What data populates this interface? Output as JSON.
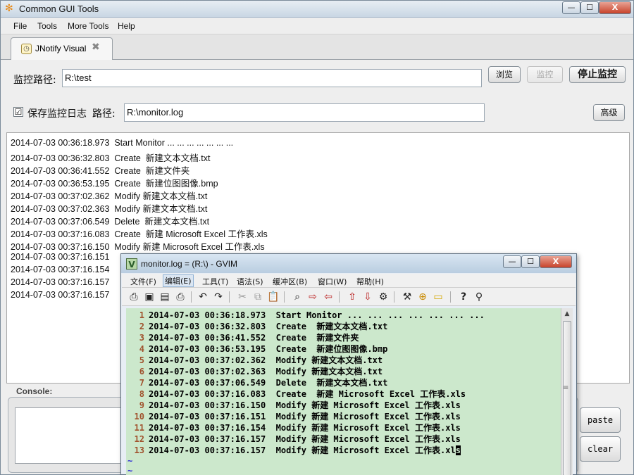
{
  "window": {
    "title": "Common GUI Tools",
    "buttons": {
      "minimize": "—",
      "maximize": "☐",
      "close": "X"
    }
  },
  "menu": [
    "File",
    "Tools",
    "More Tools",
    "Help"
  ],
  "tab": {
    "label": "JNotify Visual",
    "close": "✖",
    "icon": "◷"
  },
  "monitor": {
    "path_label": "监控路径:",
    "path_value": "R:\\test",
    "browse": "浏览",
    "monitor_btn": "监控",
    "stop_btn": "停止监控"
  },
  "logging": {
    "checkbox_label": "保存监控日志",
    "checked": "☑",
    "path_label": "路径:",
    "path_value": "R:\\monitor.log",
    "advanced": "高级"
  },
  "log_lines": [
    "2014-07-03 00:36:18.973  Start Monitor ... ... ... ... ... ... ...",
    "2014-07-03 00:36:32.803  Create  新建文本文档.txt",
    "2014-07-03 00:36:41.552  Create  新建文件夹",
    "2014-07-03 00:36:53.195  Create  新建位图图像.bmp",
    "2014-07-03 00:37:02.362  Modify 新建文本文档.txt",
    "2014-07-03 00:37:02.363  Modify 新建文本文档.txt",
    "2014-07-03 00:37:06.549  Delete  新建文本文档.txt",
    "2014-07-03 00:37:16.083  Create  新建 Microsoft Excel 工作表.xls",
    "2014-07-03 00:37:16.150  Modify 新建 Microsoft Excel 工作表.xls",
    "2014-07-03 00:37:16.151",
    "2014-07-03 00:37:16.154",
    "2014-07-03 00:37:16.157",
    "2014-07-03 00:37:16.157"
  ],
  "console": {
    "label": "Console:",
    "paste": "paste",
    "clear": "clear"
  },
  "gvim": {
    "title": "monitor.log = (R:\\) - GVIM",
    "menu": [
      "文件(F)",
      "编辑(E)",
      "工具(T)",
      "语法(S)",
      "缓冲区(B)",
      "窗口(W)",
      "帮助(H)"
    ],
    "active_menu_index": 1,
    "toolbar_icons": [
      "open-icon",
      "save-icon",
      "save-all-icon",
      "print-icon",
      "undo-icon",
      "redo-icon",
      "cut-icon",
      "copy-icon",
      "paste-icon",
      "find-replace-icon",
      "find-next-icon",
      "find-prev-icon",
      "load-session-icon",
      "save-session-icon",
      "run-script-icon",
      "make-icon",
      "shell-icon",
      "tag-jump-icon",
      "help-icon",
      "find-help-icon"
    ],
    "lines": [
      {
        "n": "1",
        "text": "2014-07-03 00:36:18.973  Start Monitor ... ... ... ... ... ... ..."
      },
      {
        "n": "2",
        "text": "2014-07-03 00:36:32.803  Create  新建文本文档.txt"
      },
      {
        "n": "3",
        "text": "2014-07-03 00:36:41.552  Create  新建文件夹"
      },
      {
        "n": "4",
        "text": "2014-07-03 00:36:53.195  Create  新建位图图像.bmp"
      },
      {
        "n": "5",
        "text": "2014-07-03 00:37:02.362  Modify 新建文本文档.txt"
      },
      {
        "n": "6",
        "text": "2014-07-03 00:37:02.363  Modify 新建文本文档.txt"
      },
      {
        "n": "7",
        "text": "2014-07-03 00:37:06.549  Delete  新建文本文档.txt"
      },
      {
        "n": "8",
        "text": "2014-07-03 00:37:16.083  Create  新建 Microsoft Excel 工作表.xls"
      },
      {
        "n": "9",
        "text": "2014-07-03 00:37:16.150  Modify 新建 Microsoft Excel 工作表.xls"
      },
      {
        "n": "10",
        "text": "2014-07-03 00:37:16.151  Modify 新建 Microsoft Excel 工作表.xls"
      },
      {
        "n": "11",
        "text": "2014-07-03 00:37:16.154  Modify 新建 Microsoft Excel 工作表.xls"
      },
      {
        "n": "12",
        "text": "2014-07-03 00:37:16.157  Modify 新建 Microsoft Excel 工作表.xls"
      },
      {
        "n": "13",
        "text": "2014-07-03 00:37:16.157  Modify 新建 Microsoft Excel 工作表.xl",
        "cursor": "s"
      }
    ],
    "tilde": "~"
  },
  "colors": {
    "vim_bg": "#cce8cc",
    "line_number": "#a0522d",
    "tilde": "#2b2bd6"
  }
}
